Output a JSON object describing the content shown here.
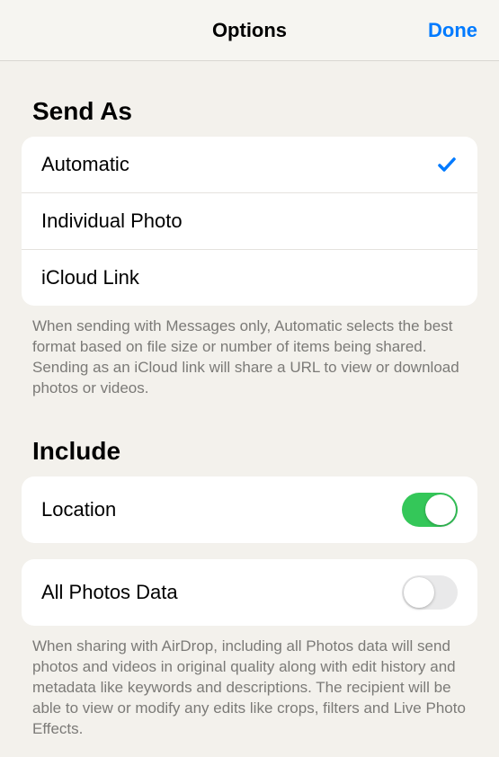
{
  "navbar": {
    "title": "Options",
    "done": "Done"
  },
  "sendAs": {
    "header": "Send As",
    "options": {
      "automatic": "Automatic",
      "individual": "Individual Photo",
      "icloud": "iCloud Link"
    },
    "selected": "automatic",
    "footer": "When sending with Messages only, Automatic selects the best format based on file size or number of items being shared. Sending as an iCloud link will share a URL to view or download photos or videos."
  },
  "include": {
    "header": "Include",
    "location": {
      "label": "Location",
      "on": true
    },
    "allPhotosData": {
      "label": "All Photos Data",
      "on": false
    },
    "footer": "When sharing with AirDrop, including all Photos data will send photos and videos in original quality along with edit history and metadata like keywords and descriptions. The recipient will be able to view or modify any edits like crops, filters and Live Photo Effects."
  }
}
